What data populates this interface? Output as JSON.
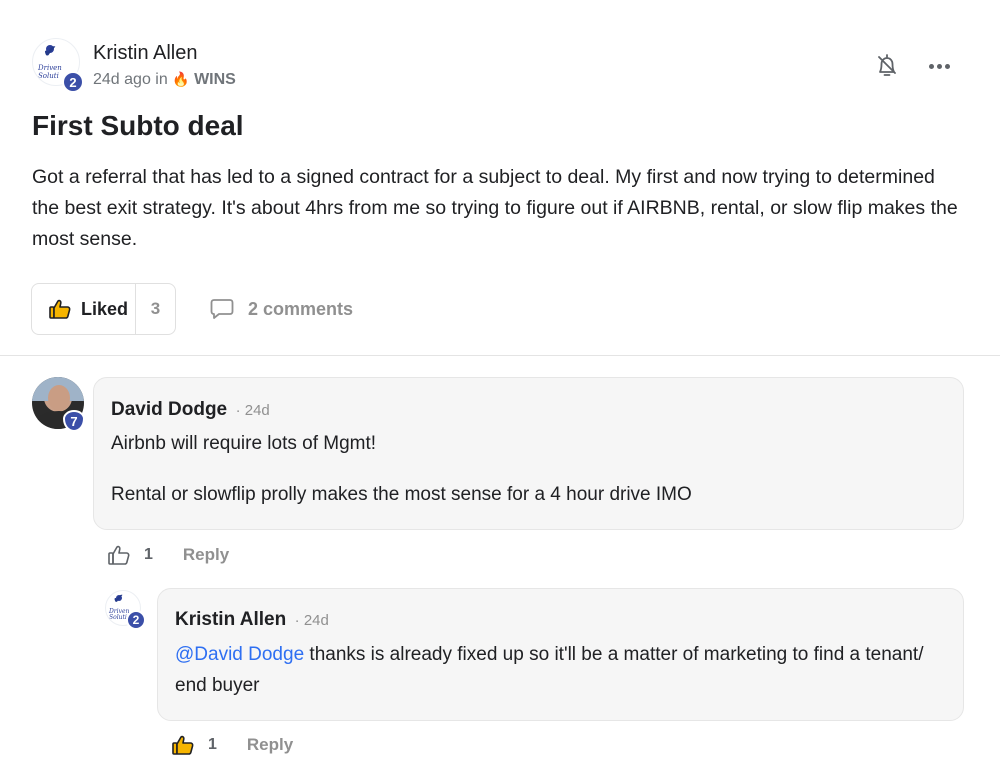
{
  "post": {
    "author": "Kristin Allen",
    "author_level": "2",
    "logo_text_line1": "Driven",
    "logo_text_line2": "Soluti",
    "time": "24d ago in",
    "category_icon": "fire-icon",
    "category": "WINS",
    "title": "First Subto deal",
    "body": "Got a referral that has led to a signed contract for a subject to deal. My first and now trying to determined the best exit strategy. It's about 4hrs from me so trying to figure out if AIRBNB, rental, or slow flip makes the most sense.",
    "like_label": "Liked",
    "like_count": "3",
    "comments_label": "2 comments"
  },
  "comments": [
    {
      "author": "David Dodge",
      "author_level": "7",
      "time": "· 24d",
      "paragraphs": [
        "Airbnb will require lots of Mgmt!",
        "Rental or slowflip prolly makes the most sense for a 4 hour drive IMO"
      ],
      "like_count": "1",
      "reply_label": "Reply"
    },
    {
      "author": "Kristin Allen",
      "author_level": "2",
      "time": "· 24d",
      "mention": "@David Dodge",
      "text": " thanks is already fixed up so it'll be a matter of marketing to find a tenant/ end buyer",
      "like_count": "1",
      "reply_label": "Reply"
    }
  ],
  "colors": {
    "accent_blue": "#2e6ff2",
    "badge_blue": "#3b4fa8",
    "fire_orange": "#f57c00",
    "muted_gray": "#909090"
  }
}
